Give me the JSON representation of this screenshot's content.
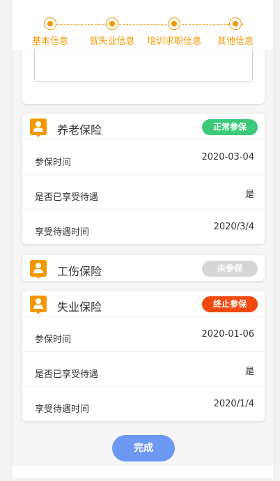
{
  "steps": [
    "基本信息",
    "就失业信息",
    "培训求职信息",
    "其他信息"
  ],
  "colors": {
    "accent": "#f39800",
    "status_normal": "#3ec97a",
    "status_none": "#d6d6d6",
    "status_stopped": "#f04a10",
    "button": "#6c98f3"
  },
  "insurances": [
    {
      "title": "养老保险",
      "icon": "person-icon",
      "status": "正常参保",
      "rows": [
        {
          "label": "参保时间",
          "value": "2020-03-04"
        },
        {
          "label": "是否已享受待遇",
          "value": "是"
        },
        {
          "label": "享受待遇时间",
          "value": "2020/3/4"
        }
      ]
    },
    {
      "title": "工伤保险",
      "icon": "person-icon",
      "status": "未参保",
      "rows": []
    },
    {
      "title": "失业保险",
      "icon": "person-icon",
      "status": "终止参保",
      "rows": [
        {
          "label": "参保时间",
          "value": "2020-01-06"
        },
        {
          "label": "是否已享受待遇",
          "value": "是"
        },
        {
          "label": "享受待遇时间",
          "value": "2020/1/4"
        }
      ]
    }
  ],
  "buttons": {
    "done": "完成"
  }
}
